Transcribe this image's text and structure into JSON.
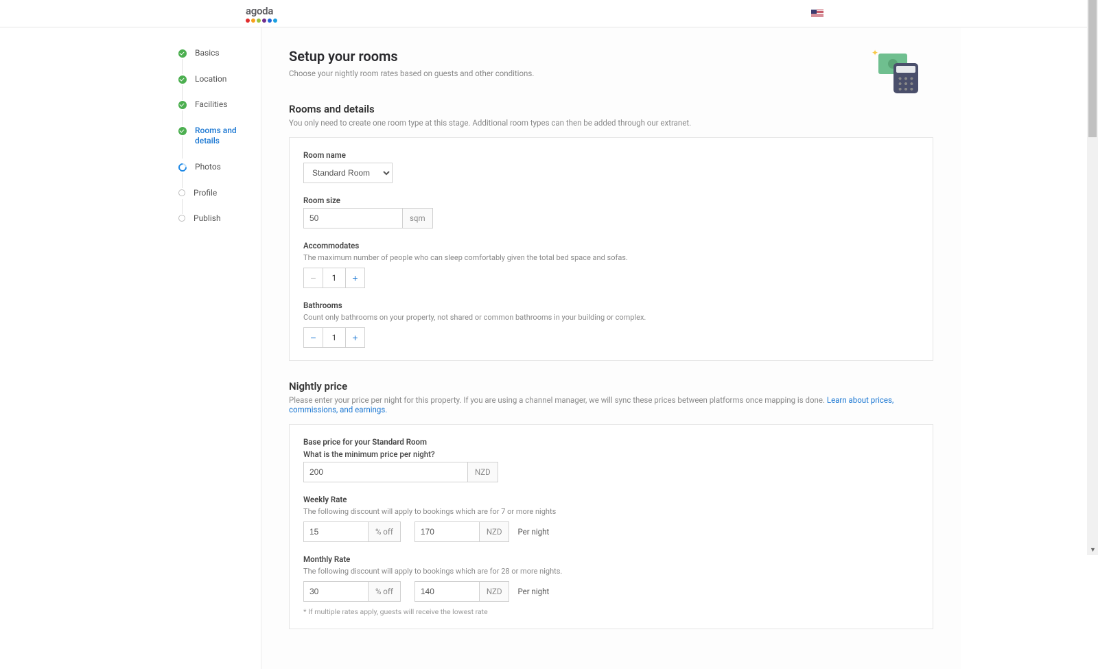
{
  "header": {
    "brand": "agoda",
    "locale_flag": "us"
  },
  "sidebar": {
    "steps": [
      {
        "label": "Basics",
        "status": "done"
      },
      {
        "label": "Location",
        "status": "done"
      },
      {
        "label": "Facilities",
        "status": "done"
      },
      {
        "label": "Rooms and details",
        "status": "done",
        "active": true
      },
      {
        "label": "Photos",
        "status": "current"
      },
      {
        "label": "Profile",
        "status": "pending"
      },
      {
        "label": "Publish",
        "status": "pending"
      }
    ]
  },
  "main": {
    "title": "Setup your rooms",
    "subtitle": "Choose your nightly room rates based on guests and other conditions.",
    "rooms": {
      "heading": "Rooms and details",
      "sub": "You only need to create one room type at this stage. Additional room types can then be added through our extranet.",
      "room_name_label": "Room name",
      "room_name_value": "Standard Room",
      "room_size_label": "Room size",
      "room_size_value": "50",
      "room_size_unit": "sqm",
      "accommodates_label": "Accommodates",
      "accommodates_desc": "The maximum number of people who can sleep comfortably given the total bed space and sofas.",
      "accommodates_value": "1",
      "bathrooms_label": "Bathrooms",
      "bathrooms_desc": "Count only bathrooms on your property, not shared or common bathrooms in your building or complex.",
      "bathrooms_value": "1"
    },
    "price": {
      "heading": "Nightly price",
      "sub_a": "Please enter your price per night for this property. If you are using a channel manager, we will sync these prices between platforms once mapping is done. ",
      "sub_link": "Learn about prices, commissions, and earnings.",
      "base_label": "Base price for your Standard Room",
      "min_label": "What is the minimum price per night?",
      "min_value": "200",
      "currency": "NZD",
      "weekly_label": "Weekly Rate",
      "weekly_desc": "The following discount will apply to bookings which are for 7 or more nights",
      "weekly_pct": "15",
      "pct_off": "% off",
      "weekly_rate": "170",
      "per_night": "Per night",
      "monthly_label": "Monthly Rate",
      "monthly_desc": "The following discount will apply to bookings which are for 28 or more nights.",
      "monthly_pct": "30",
      "monthly_rate": "140",
      "footnote": "* If multiple rates apply, guests will receive the lowest rate"
    }
  }
}
